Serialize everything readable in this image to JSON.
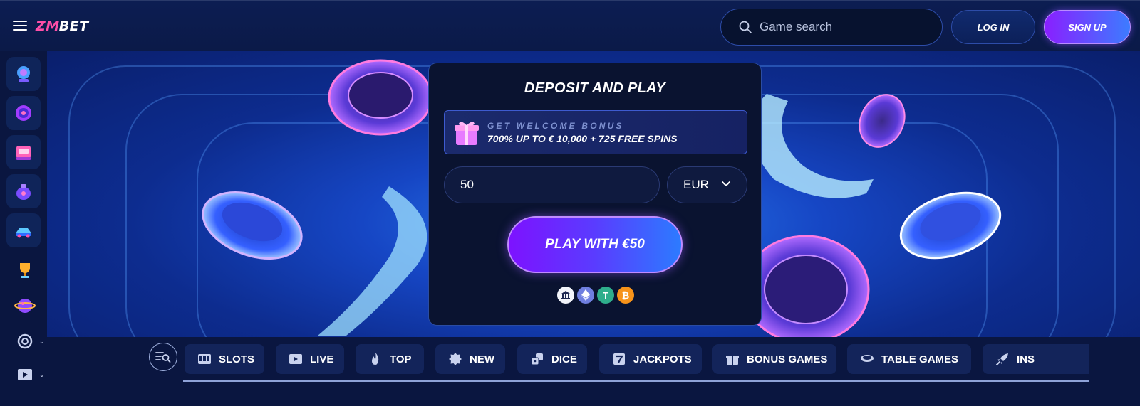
{
  "header": {
    "logo_mark": "ZM",
    "logo_rest": " BET",
    "search_placeholder": "Game search",
    "login_label": "LOG IN",
    "signup_label": "SIGN UP"
  },
  "sidebar": {
    "items": [
      {
        "icon": "crystal-ball-icon"
      },
      {
        "icon": "target-icon"
      },
      {
        "icon": "slot-machine-icon"
      },
      {
        "icon": "money-bag-icon"
      },
      {
        "icon": "race-car-icon"
      },
      {
        "icon": "trophy-icon"
      },
      {
        "icon": "planet-icon"
      },
      {
        "icon": "settings-wheel-icon"
      },
      {
        "icon": "play-video-icon"
      }
    ]
  },
  "deposit": {
    "title": "DEPOSIT AND PLAY",
    "bonus_label": "GET WELCOME BONUS",
    "bonus_offer": "700% UP TO € 10,000 + 725 FREE SPINS",
    "amount_value": "50",
    "currency": "EUR",
    "play_label": "PLAY WITH €50",
    "payment_methods": [
      "bank-icon",
      "ethereum-icon",
      "tether-icon",
      "bitcoin-icon"
    ]
  },
  "categories": [
    {
      "label": "SLOTS",
      "icon": "slots-icon"
    },
    {
      "label": "LIVE",
      "icon": "live-icon"
    },
    {
      "label": "TOP",
      "icon": "flame-icon"
    },
    {
      "label": "NEW",
      "icon": "new-badge-icon"
    },
    {
      "label": "DICE",
      "icon": "dice-icon"
    },
    {
      "label": "JACKPOTS",
      "icon": "seven-icon"
    },
    {
      "label": "BONUS GAMES",
      "icon": "gift-icon"
    },
    {
      "label": "TABLE GAMES",
      "icon": "table-icon"
    },
    {
      "label": "INS",
      "icon": "rocket-icon"
    }
  ],
  "colors": {
    "background": "#0a1a45",
    "accent_purple": "#8a1fff",
    "accent_blue": "#3c7cff",
    "accent_pink": "#ff4fa8"
  }
}
